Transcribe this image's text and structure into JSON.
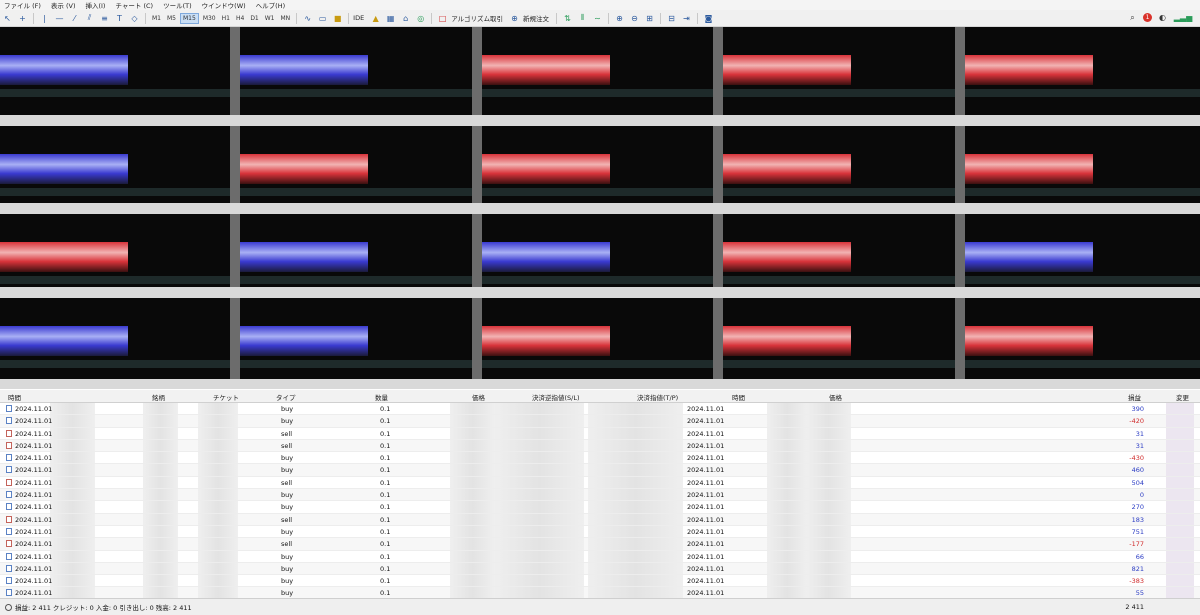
{
  "menu": [
    "ファイル (F)",
    "表示 (V)",
    "挿入(I)",
    "チャート (C)",
    "ツール(T)",
    "ウインドウ(W)",
    "ヘルプ(H)"
  ],
  "toolbar": {
    "timeframes": [
      "M1",
      "M5",
      "M15",
      "M30",
      "H1",
      "H4",
      "D1",
      "W1",
      "MN"
    ],
    "active_timeframe": "M15",
    "ide_label": "IDE",
    "algo_label": "アルゴリズム取引",
    "new_order_label": "新規注文",
    "notification_count": "1"
  },
  "table": {
    "columns": [
      "時間",
      "銘柄",
      "チケット",
      "タイプ",
      "数量",
      "価格",
      "決済逆指値(S/L)",
      "決済指値(T/P)",
      "時間",
      "価格",
      "損益",
      "変更"
    ],
    "rows": [
      {
        "time": "2024.11.01",
        "type": "buy",
        "volume": "0.1",
        "close_time": "2024.11.01",
        "profit": "390",
        "sign": "pos"
      },
      {
        "time": "2024.11.01",
        "type": "buy",
        "volume": "0.1",
        "close_time": "2024.11.01",
        "profit": "-420",
        "sign": "neg"
      },
      {
        "time": "2024.11.01",
        "type": "sell",
        "volume": "0.1",
        "close_time": "2024.11.01",
        "profit": "31",
        "sign": "pos"
      },
      {
        "time": "2024.11.01",
        "type": "sell",
        "volume": "0.1",
        "close_time": "2024.11.01",
        "profit": "31",
        "sign": "pos"
      },
      {
        "time": "2024.11.01",
        "type": "buy",
        "volume": "0.1",
        "close_time": "2024.11.01",
        "profit": "-430",
        "sign": "neg"
      },
      {
        "time": "2024.11.01",
        "type": "buy",
        "volume": "0.1",
        "close_time": "2024.11.01",
        "profit": "460",
        "sign": "pos"
      },
      {
        "time": "2024.11.01",
        "type": "sell",
        "volume": "0.1",
        "close_time": "2024.11.01",
        "profit": "504",
        "sign": "pos"
      },
      {
        "time": "2024.11.01",
        "type": "buy",
        "volume": "0.1",
        "close_time": "2024.11.01",
        "profit": "0",
        "sign": "pos"
      },
      {
        "time": "2024.11.01",
        "type": "buy",
        "volume": "0.1",
        "close_time": "2024.11.01",
        "profit": "270",
        "sign": "pos"
      },
      {
        "time": "2024.11.01",
        "type": "sell",
        "volume": "0.1",
        "close_time": "2024.11.01",
        "profit": "183",
        "sign": "pos"
      },
      {
        "time": "2024.11.01",
        "type": "buy",
        "volume": "0.1",
        "close_time": "2024.11.01",
        "profit": "751",
        "sign": "pos"
      },
      {
        "time": "2024.11.01",
        "type": "sell",
        "volume": "0.1",
        "close_time": "2024.11.01",
        "profit": "-177",
        "sign": "neg"
      },
      {
        "time": "2024.11.01",
        "type": "buy",
        "volume": "0.1",
        "close_time": "2024.11.01",
        "profit": "66",
        "sign": "pos"
      },
      {
        "time": "2024.11.01",
        "type": "buy",
        "volume": "0.1",
        "close_time": "2024.11.01",
        "profit": "821",
        "sign": "pos"
      },
      {
        "time": "2024.11.01",
        "type": "buy",
        "volume": "0.1",
        "close_time": "2024.11.01",
        "profit": "-383",
        "sign": "neg"
      },
      {
        "time": "2024.11.01",
        "type": "buy",
        "volume": "0.1",
        "close_time": "2024.11.01",
        "profit": "55",
        "sign": "pos"
      },
      {
        "time": "2024.11.01",
        "type": "buy",
        "volume": "0.1",
        "close_time": "2024.11.01",
        "profit": "-71",
        "sign": "neg"
      }
    ]
  },
  "status": {
    "summary": "損益: 2 411  クレジット: 0  入金: 0  引き出し: 0  残高: 2 411",
    "total": "2 411"
  },
  "colors": {
    "buy_panel": "#3a3ad0",
    "sell_panel": "#d8333a",
    "profit_positive": "#2b3cc4",
    "profit_negative": "#d02a2a"
  },
  "chart_grid": [
    [
      "buy",
      "buy",
      "sell",
      "sell",
      "sell"
    ],
    [
      "buy",
      "sell",
      "sell",
      "sell",
      "sell"
    ],
    [
      "sell",
      "buy",
      "buy",
      "sell",
      "buy"
    ],
    [
      "buy",
      "buy",
      "sell",
      "sell",
      "sell"
    ]
  ]
}
